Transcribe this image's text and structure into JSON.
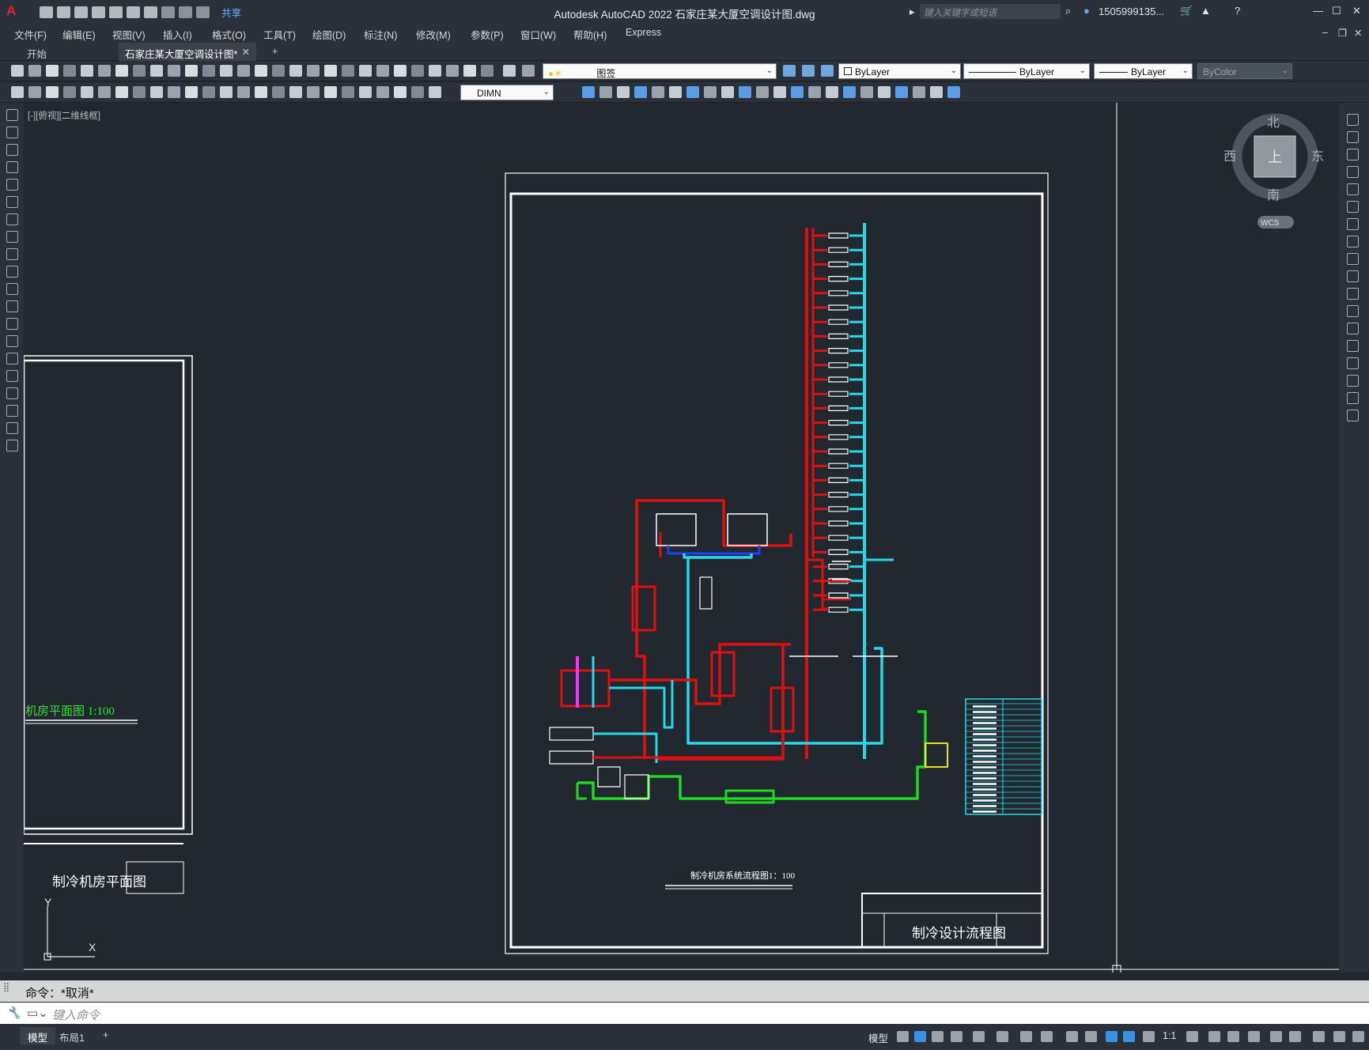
{
  "app": {
    "title": "Autodesk AutoCAD 2022    石家庄某大厦空调设计图.dwg",
    "logo": "A",
    "share": "共享"
  },
  "search": {
    "placeholder": "键入关键字或短语"
  },
  "user": {
    "name": "1505999135..."
  },
  "menu": [
    "文件(F)",
    "编辑(E)",
    "视图(V)",
    "插入(I)",
    "格式(O)",
    "工具(T)",
    "绘图(D)",
    "标注(N)",
    "修改(M)",
    "参数(P)",
    "窗口(W)",
    "帮助(H)",
    "Express"
  ],
  "tabs": [
    {
      "label": "开始"
    },
    {
      "label": "石家庄某大厦空调设计图*"
    }
  ],
  "properties": {
    "layer": "图签",
    "color": "ByLayer",
    "linetype": "ByLayer",
    "lineweight": "ByLayer",
    "plotstyle": "ByColor",
    "dimstyle": "DIMN"
  },
  "viewport": {
    "label": "[-][俯视][二维线框]"
  },
  "viewcube": {
    "north": "北",
    "south": "南",
    "east": "东",
    "west": "西",
    "top": "上",
    "wcs": "WCS"
  },
  "drawing": {
    "left_plan_caption": "机房平面图 1:100",
    "left_title_block": "制冷机房平面图",
    "flow_caption": "制冷机房系统流程图1：100",
    "right_title_block": "制冷设计流程图"
  },
  "command": {
    "history": "命令：*取消*",
    "placeholder": "键入命令"
  },
  "layouts": [
    {
      "label": "模型"
    },
    {
      "label": "布局1"
    }
  ],
  "status": {
    "model": "模型",
    "scale": "1:1"
  },
  "colors": {
    "supply": "#e01010",
    "return": "#28d8e8",
    "condensate": "#20d820",
    "pump": "#ff30ff",
    "blue": "#2040ff",
    "yellow": "#e8e020"
  }
}
